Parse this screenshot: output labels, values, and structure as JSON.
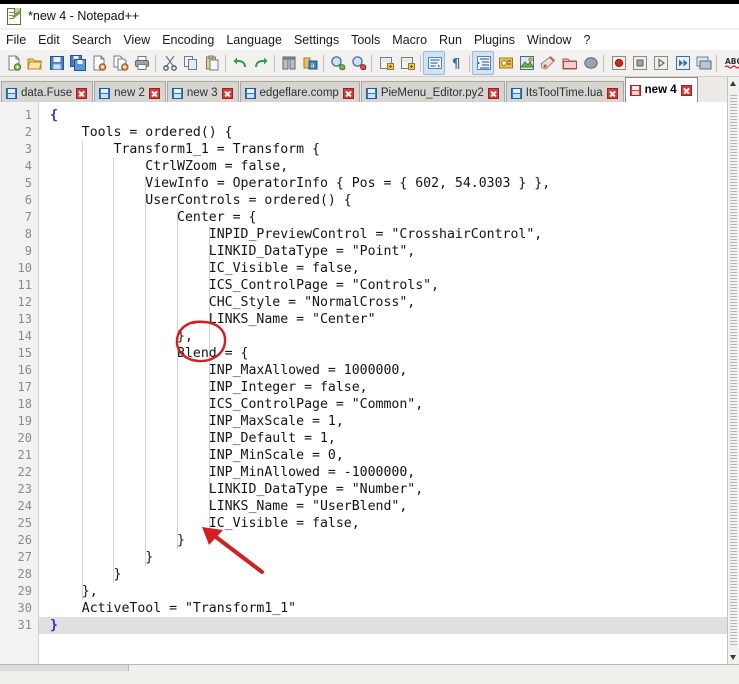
{
  "window": {
    "title": "*new 4 - Notepad++",
    "app_icon": "notepad-plus-plus-icon"
  },
  "menu": {
    "items": [
      {
        "label": "File"
      },
      {
        "label": "Edit"
      },
      {
        "label": "Search"
      },
      {
        "label": "View"
      },
      {
        "label": "Encoding"
      },
      {
        "label": "Language"
      },
      {
        "label": "Settings"
      },
      {
        "label": "Tools"
      },
      {
        "label": "Macro"
      },
      {
        "label": "Run"
      },
      {
        "label": "Plugins"
      },
      {
        "label": "Window"
      },
      {
        "label": "?"
      }
    ]
  },
  "toolbar": {
    "buttons": [
      {
        "name": "new-file-icon",
        "tip": "New"
      },
      {
        "name": "open-file-icon",
        "tip": "Open"
      },
      {
        "name": "save-icon",
        "tip": "Save"
      },
      {
        "name": "save-all-icon",
        "tip": "Save All"
      },
      {
        "name": "close-file-icon",
        "tip": "Close"
      },
      {
        "name": "close-all-icon",
        "tip": "Close All"
      },
      {
        "name": "print-icon",
        "tip": "Print"
      },
      {
        "name": "separator",
        "tip": ""
      },
      {
        "name": "cut-icon",
        "tip": "Cut"
      },
      {
        "name": "copy-icon",
        "tip": "Copy"
      },
      {
        "name": "paste-icon",
        "tip": "Paste"
      },
      {
        "name": "separator",
        "tip": ""
      },
      {
        "name": "undo-icon",
        "tip": "Undo"
      },
      {
        "name": "redo-icon",
        "tip": "Redo"
      },
      {
        "name": "separator",
        "tip": ""
      },
      {
        "name": "find-icon",
        "tip": "Find"
      },
      {
        "name": "replace-icon",
        "tip": "Replace"
      },
      {
        "name": "separator",
        "tip": ""
      },
      {
        "name": "zoom-in-icon",
        "tip": "Zoom In"
      },
      {
        "name": "zoom-out-icon",
        "tip": "Zoom Out"
      },
      {
        "name": "separator",
        "tip": ""
      },
      {
        "name": "sync-vertical-icon",
        "tip": "Synchronize Vertical Scrolling"
      },
      {
        "name": "sync-horizontal-icon",
        "tip": "Synchronize Horizontal Scrolling"
      },
      {
        "name": "separator",
        "tip": ""
      },
      {
        "name": "word-wrap-icon",
        "tip": "Word wrap"
      },
      {
        "name": "show-all-chars-icon",
        "tip": "Show All Characters"
      },
      {
        "name": "separator",
        "tip": ""
      },
      {
        "name": "indent-guide-icon",
        "tip": "Show Indent Guide"
      },
      {
        "name": "uppercase-icon",
        "tip": "UPPERCASE"
      },
      {
        "name": "user-define-dialog-icon",
        "tip": "User Defined Dialogue"
      },
      {
        "name": "function-list-icon",
        "tip": "Function List"
      },
      {
        "name": "folder-workspace-icon",
        "tip": "Folder as Workspace"
      },
      {
        "name": "document-map-icon",
        "tip": "Document Map"
      },
      {
        "name": "separator",
        "tip": ""
      },
      {
        "name": "record-macro-icon",
        "tip": "Start Recording"
      },
      {
        "name": "stop-macro-icon",
        "tip": "Stop Recording"
      },
      {
        "name": "play-macro-icon",
        "tip": "Playback"
      },
      {
        "name": "run-macro-multiple-icon",
        "tip": "Run a Macro Multiple Times"
      },
      {
        "name": "save-macro-icon",
        "tip": "Save Currently Recorded Macro"
      },
      {
        "name": "separator",
        "tip": ""
      },
      {
        "name": "spell-check-icon",
        "tip": "Spell Check"
      }
    ]
  },
  "tabs": {
    "items": [
      {
        "label": "data.Fuse",
        "active": false,
        "modified": false
      },
      {
        "label": "new 2",
        "active": false,
        "modified": false
      },
      {
        "label": "new 3",
        "active": false,
        "modified": false
      },
      {
        "label": "edgeflare.comp",
        "active": false,
        "modified": false
      },
      {
        "label": "PieMenu_Editor.py2",
        "active": false,
        "modified": false
      },
      {
        "label": "ItsToolTime.lua",
        "active": false,
        "modified": false
      },
      {
        "label": "new 4",
        "active": true,
        "modified": true
      }
    ]
  },
  "editor": {
    "current_line": 31,
    "lines": [
      {
        "n": 1,
        "text": "{",
        "brace": true
      },
      {
        "n": 2,
        "text": "    Tools = ordered() {"
      },
      {
        "n": 3,
        "text": "        Transform1_1 = Transform {"
      },
      {
        "n": 4,
        "text": "            CtrlWZoom = false,"
      },
      {
        "n": 5,
        "text": "            ViewInfo = OperatorInfo { Pos = { 602, 54.0303 } },"
      },
      {
        "n": 6,
        "text": "            UserControls = ordered() {"
      },
      {
        "n": 7,
        "text": "                Center = {"
      },
      {
        "n": 8,
        "text": "                    INPID_PreviewControl = \"CrosshairControl\","
      },
      {
        "n": 9,
        "text": "                    LINKID_DataType = \"Point\","
      },
      {
        "n": 10,
        "text": "                    IC_Visible = false,"
      },
      {
        "n": 11,
        "text": "                    ICS_ControlPage = \"Controls\","
      },
      {
        "n": 12,
        "text": "                    CHC_Style = \"NormalCross\","
      },
      {
        "n": 13,
        "text": "                    LINKS_Name = \"Center\""
      },
      {
        "n": 14,
        "text": "                },"
      },
      {
        "n": 15,
        "text": "                Blend = {"
      },
      {
        "n": 16,
        "text": "                    INP_MaxAllowed = 1000000,"
      },
      {
        "n": 17,
        "text": "                    INP_Integer = false,"
      },
      {
        "n": 18,
        "text": "                    ICS_ControlPage = \"Common\","
      },
      {
        "n": 19,
        "text": "                    INP_MaxScale = 1,"
      },
      {
        "n": 20,
        "text": "                    INP_Default = 1,"
      },
      {
        "n": 21,
        "text": "                    INP_MinScale = 0,"
      },
      {
        "n": 22,
        "text": "                    INP_MinAllowed = -1000000,"
      },
      {
        "n": 23,
        "text": "                    LINKID_DataType = \"Number\","
      },
      {
        "n": 24,
        "text": "                    LINKS_Name = \"UserBlend\","
      },
      {
        "n": 25,
        "text": "                    IC_Visible = false,"
      },
      {
        "n": 26,
        "text": "                }"
      },
      {
        "n": 27,
        "text": "            }"
      },
      {
        "n": 28,
        "text": "        }"
      },
      {
        "n": 29,
        "text": "    },"
      },
      {
        "n": 30,
        "text": "    ActiveTool = \"Transform1_1\""
      },
      {
        "n": 31,
        "text": "}",
        "brace": true
      }
    ]
  },
  "annotations": {
    "color": "#d31f1f",
    "items": [
      {
        "name": "red-ellipse-highlight",
        "target_line": 14,
        "description": "hand drawn red circle around closing brace"
      },
      {
        "name": "red-arrow-pointer",
        "target_line": 26,
        "description": "hand drawn red arrow pointing at closing brace"
      }
    ]
  },
  "statusbar": {
    "text": ""
  }
}
